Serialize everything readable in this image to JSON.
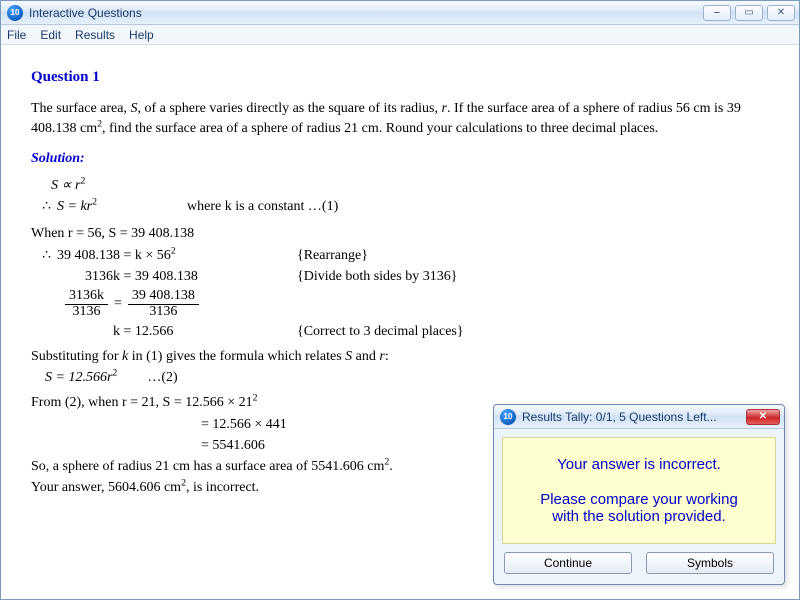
{
  "titlebar": {
    "app_icon_label": "10",
    "title": "Interactive Questions",
    "min": "⎯",
    "max": "▭",
    "close": "✕"
  },
  "menubar": [
    "File",
    "Edit",
    "Results",
    "Help"
  ],
  "question": {
    "number_label": "Question 1",
    "prompt_a": "The surface area, ",
    "prompt_S": "S",
    "prompt_b": ", of a sphere varies directly as the square of its radius, ",
    "prompt_r": "r",
    "prompt_c": ".  If the surface area of a sphere of radius 56 cm is 39 408.138 cm",
    "prompt_sup": "2",
    "prompt_d": ", find the surface area of a sphere of radius 21 cm.  Round your calculations to three decimal places."
  },
  "solution": {
    "label": "Solution:",
    "row1": "S ∝ r",
    "row1_sup": "2",
    "row2_pre": "∴",
    "row2_eq": "S = kr",
    "row2_sup": "2",
    "row2_ann": "where k is a constant       …(1)",
    "when_text": "When r = 56, S = 39 408.138",
    "row3_pre": "∴",
    "row3_eq": "39 408.138 = k × 56",
    "row3_sup": "2",
    "row3_ann": "{Rearrange}",
    "row4_eq": "3136k = 39 408.138",
    "row4_ann": "{Divide both sides by 3136}",
    "frac_l_num": "3136k",
    "frac_l_den": "3136",
    "frac_eq": "=",
    "frac_r_num": "39 408.138",
    "frac_r_den": "3136",
    "row6_eq": "k = 12.566",
    "row6_ann": "{Correct to 3 decimal places}",
    "subst_a": "Substituting for ",
    "subst_k": "k",
    "subst_b": " in (1) gives the formula which relates ",
    "subst_S": "S",
    "subst_c": " and ",
    "subst_r": "r",
    "subst_d": ":",
    "formula_eq": "S = 12.566r",
    "formula_sup": "2",
    "formula_ann": "…(2)",
    "from2_a": "From (2), when r = 21, S = 12.566 × 21",
    "from2_sup": "2",
    "calc2": "= 12.566 × 441",
    "calc3": "= 5541.606",
    "final_a": "So, a sphere of radius 21 cm has a surface area of 5541.606 cm",
    "final_sup": "2",
    "final_b": ".",
    "answer_a": "Your answer, 5604.606 cm",
    "answer_sup": "2",
    "answer_b": ", is incorrect."
  },
  "popup": {
    "icon_label": "10",
    "title": "Results Tally:  0/1, 5 Questions Left...",
    "close": "✕",
    "message1": "Your answer is incorrect.",
    "message2a": "Please compare your working",
    "message2b": "with the solution provided.",
    "btn_continue": "Continue",
    "btn_symbols": "Symbols"
  }
}
